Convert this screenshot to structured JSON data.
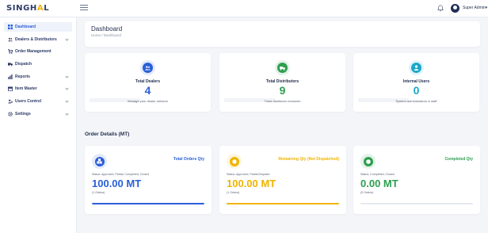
{
  "brand": {
    "name_prefix": "SINGH",
    "name_accent": "A",
    "name_suffix": "L"
  },
  "topbar": {
    "user_name": "Super Admin",
    "user_caret": "▾"
  },
  "sidebar": {
    "items": [
      {
        "label": "Dashboard",
        "icon": "grid-icon",
        "active": true,
        "has_chevron": false
      },
      {
        "label": "Dealers & Distributors",
        "icon": "users-icon",
        "active": false,
        "has_chevron": true
      },
      {
        "label": "Order Management",
        "icon": "cart-icon",
        "active": false,
        "has_chevron": false
      },
      {
        "label": "Dispatch",
        "icon": "truck-icon",
        "active": false,
        "has_chevron": false
      },
      {
        "label": "Reports",
        "icon": "chart-icon",
        "active": false,
        "has_chevron": true
      },
      {
        "label": "Item Master",
        "icon": "box-icon",
        "active": false,
        "has_chevron": true
      },
      {
        "label": "Users Control",
        "icon": "user-gear-icon",
        "active": false,
        "has_chevron": true
      },
      {
        "label": "Settings",
        "icon": "gear-icon",
        "active": false,
        "has_chevron": true
      }
    ]
  },
  "header": {
    "title": "Dashboard",
    "breadcrumb_home": "Home",
    "breadcrumb_sep": "/",
    "breadcrumb_current": "Dashboard"
  },
  "stats": [
    {
      "title": "Total Dealers",
      "value": "4",
      "desc": "Manage your dealer network",
      "color": "#2a5fd8",
      "icon": "users-icon"
    },
    {
      "title": "Total Distributors",
      "value": "9",
      "desc": "Track distributor channels",
      "color": "#2e9e4f",
      "icon": "truck-icon"
    },
    {
      "title": "Internal Users",
      "value": "0",
      "desc": "System administrators & staff",
      "color": "#1aa8c9",
      "icon": "user-icon"
    }
  ],
  "orders_section": {
    "title": "Order Details (MT)"
  },
  "orders": [
    {
      "label": "Total Orders Qty",
      "status": "Status: Approved, Partial, Completed, Closed",
      "value": "100.00 MT",
      "count": "(1 Orders)",
      "color": "#2a5fd8",
      "progress": 1.0,
      "icon": "boxes-icon"
    },
    {
      "label": "Remaining Qty (Not Dispatched)",
      "status": "Status: Approved, Partial Dispatch",
      "value": "100.00 MT",
      "count": "(1 Orders)",
      "color": "#f0b400",
      "progress": 1.0,
      "icon": "clock-icon"
    },
    {
      "label": "Completed Qty",
      "status": "Status: Completed, Closed",
      "value": "0.00 MT",
      "count": "(0 Orders)",
      "color": "#2e9e4f",
      "progress": 0.0,
      "icon": "check-icon"
    }
  ]
}
